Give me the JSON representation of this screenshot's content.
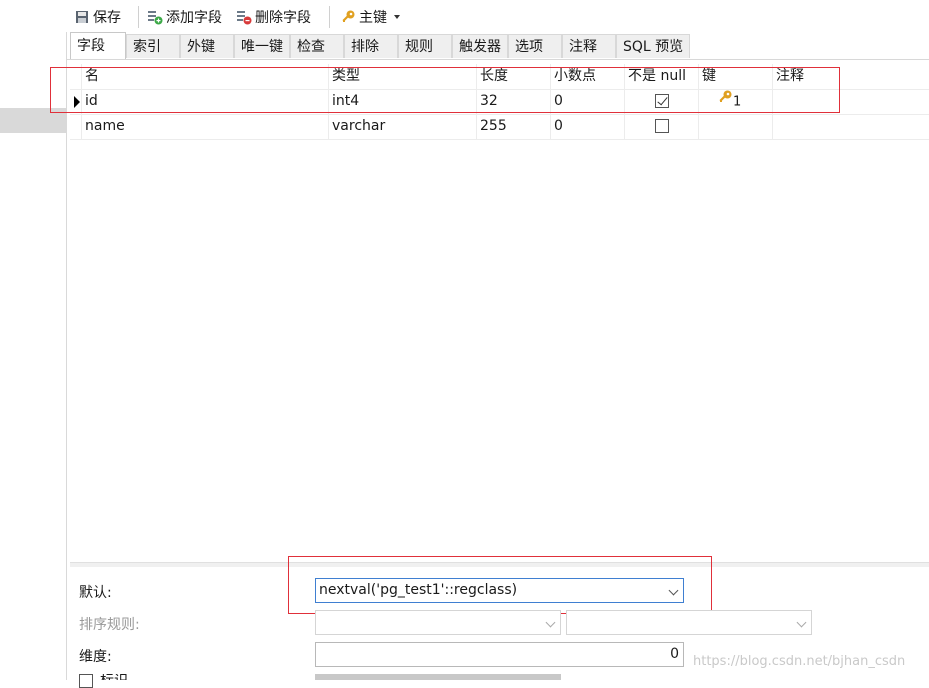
{
  "toolbar": {
    "save": "保存",
    "add_field": "添加字段",
    "delete_field": "删除字段",
    "primary_key": "主键"
  },
  "tabs": [
    "字段",
    "索引",
    "外键",
    "唯一键",
    "检查",
    "排除",
    "规则",
    "触发器",
    "选项",
    "注释",
    "SQL 预览"
  ],
  "active_tab": "字段",
  "columns": [
    "名",
    "类型",
    "长度",
    "小数点",
    "不是 null",
    "键",
    "注释"
  ],
  "rows": [
    {
      "name": "id",
      "type": "int4",
      "length": "32",
      "decimals": "0",
      "not_null": true,
      "key": "1",
      "comment": "",
      "current": true
    },
    {
      "name": "name",
      "type": "varchar",
      "length": "255",
      "decimals": "0",
      "not_null": false,
      "key": "",
      "comment": "",
      "current": false
    }
  ],
  "properties": {
    "default_label": "默认:",
    "default_value": "nextval('pg_test1'::regclass)",
    "collation_label": "排序规则:",
    "dimension_label": "维度:",
    "dimension_value": "0",
    "partial_label": "标识"
  },
  "watermark": "https://blog.csdn.net/bjhan_csdn",
  "colors": {
    "highlight": "#e0303a",
    "key_icon": "#e0a020",
    "focus": "#3f7fd1"
  }
}
